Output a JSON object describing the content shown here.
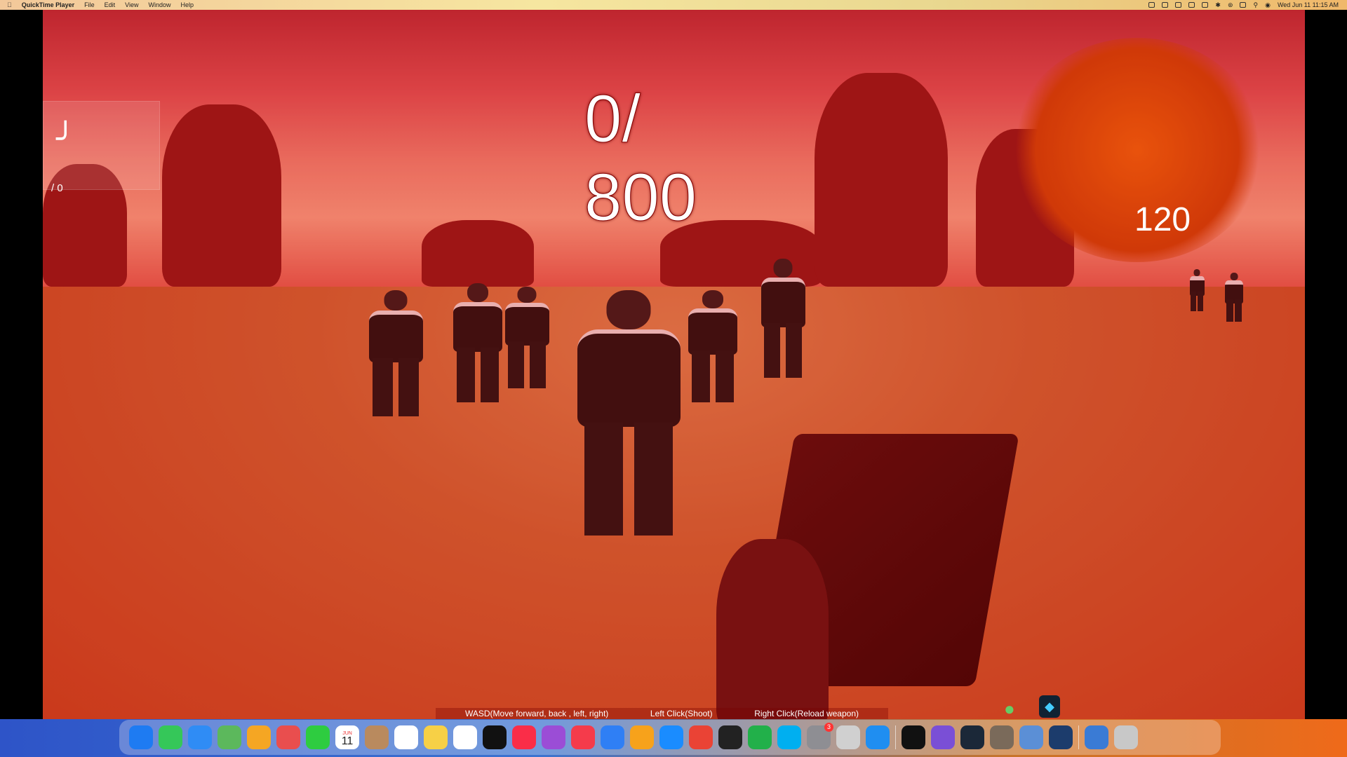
{
  "menubar": {
    "app_name": "QuickTime Player",
    "items": [
      "File",
      "Edit",
      "View",
      "Window",
      "Help"
    ],
    "clock": "Wed Jun 11  11:15 AM"
  },
  "hud": {
    "ammo": "/ 0",
    "kill_count_line1": "0/",
    "kill_count_line2": "800",
    "health": "120",
    "controls": {
      "move": "WASD(Move forward, back , left, right)",
      "shoot": "Left Click(Shoot)",
      "reload": "Right Click(Reload weapon)"
    }
  },
  "dock": {
    "calendar_month": "JUN",
    "calendar_day": "11",
    "settings_badge": "3",
    "apps": [
      {
        "name": "finder",
        "color": "#1e7bf2"
      },
      {
        "name": "messages",
        "color": "#35c759"
      },
      {
        "name": "mail",
        "color": "#2f8cf5"
      },
      {
        "name": "maps",
        "color": "#5cb85c"
      },
      {
        "name": "photos",
        "color": "#f5a623"
      },
      {
        "name": "launchpad",
        "color": "#e94e4e"
      },
      {
        "name": "facetime",
        "color": "#2ecc40"
      },
      {
        "name": "calendar",
        "color": "#ffffff"
      },
      {
        "name": "contacts",
        "color": "#b98a5e"
      },
      {
        "name": "reminders",
        "color": "#ffffff"
      },
      {
        "name": "notes",
        "color": "#f7d046"
      },
      {
        "name": "freeform",
        "color": "#ffffff"
      },
      {
        "name": "apple-tv",
        "color": "#111111"
      },
      {
        "name": "music",
        "color": "#fa2d48"
      },
      {
        "name": "podcasts",
        "color": "#9b4dd6"
      },
      {
        "name": "news",
        "color": "#f53b4b"
      },
      {
        "name": "keynote",
        "color": "#2f7ff5"
      },
      {
        "name": "pages",
        "color": "#f7a21b"
      },
      {
        "name": "app-store",
        "color": "#1a8cff"
      },
      {
        "name": "chrome",
        "color": "#ea4335"
      },
      {
        "name": "unity",
        "color": "#222222"
      },
      {
        "name": "numbers",
        "color": "#22b04a"
      },
      {
        "name": "skype",
        "color": "#00aff0"
      },
      {
        "name": "system-settings",
        "color": "#8e8e93"
      },
      {
        "name": "help",
        "color": "#d0d0d0"
      },
      {
        "name": "safari",
        "color": "#1f8ef1"
      },
      {
        "name": "terminal",
        "color": "#111111"
      },
      {
        "name": "visual-studio",
        "color": "#7a4fd6"
      },
      {
        "name": "steam",
        "color": "#1b2838"
      },
      {
        "name": "gimp",
        "color": "#7a6a5a"
      },
      {
        "name": "preview",
        "color": "#5b8fd6"
      },
      {
        "name": "quicktime",
        "color": "#1c3c6c"
      },
      {
        "name": "downloads",
        "color": "#3a7bd5"
      },
      {
        "name": "trash",
        "color": "#c8c8c8"
      }
    ]
  }
}
